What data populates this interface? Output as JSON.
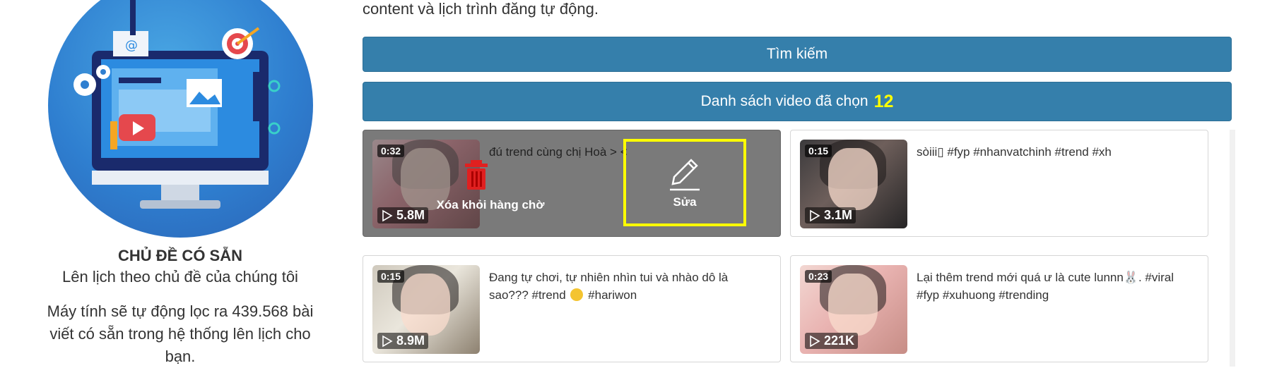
{
  "intro": {
    "text": "content và lịch trình đăng tự động."
  },
  "left": {
    "title": "CHỦ ĐỀ CÓ SẴN",
    "subtitle": "Lên lịch theo chủ đề của chúng tôi",
    "description": "Máy tính sẽ tự động lọc ra 439.568 bài viết có sẵn trong hệ thống lên lịch cho bạn."
  },
  "buttons": {
    "search_label": "Tìm kiếm",
    "selected_label": "Danh sách video đã chọn",
    "selected_count": "12"
  },
  "videos": [
    {
      "duration": "0:32",
      "views": "5.8M",
      "caption": "đú trend cùng chị Hoà > <",
      "hovered": true,
      "delete_label": "Xóa khỏi hàng chờ",
      "edit_label": "Sửa"
    },
    {
      "duration": "0:15",
      "views": "3.1M",
      "caption": "sòiii▯ #fyp #nhanvatchinh #trend #xh",
      "hovered": false
    },
    {
      "duration": "0:15",
      "views": "8.9M",
      "caption_part1": "Đang tự chơi, tự nhiên nhìn tui và nhào dô là sao???   #trend",
      "caption_part2": "#hariwon",
      "hovered": false
    },
    {
      "duration": "0:23",
      "views": "221K",
      "caption": "Lại thêm trend mới quá ư là cute lunnn🐰. #viral #fyp #xuhuong #trending",
      "hovered": false
    }
  ],
  "colors": {
    "button_bg": "#357fab",
    "count_highlight": "#ffff00",
    "edit_highlight_border": "#ffff00",
    "delete_icon": "#e02020",
    "hover_overlay": "#7a7a7a"
  },
  "icons": {
    "delete": "trash-icon",
    "edit": "pencil-icon",
    "play": "play-icon"
  }
}
